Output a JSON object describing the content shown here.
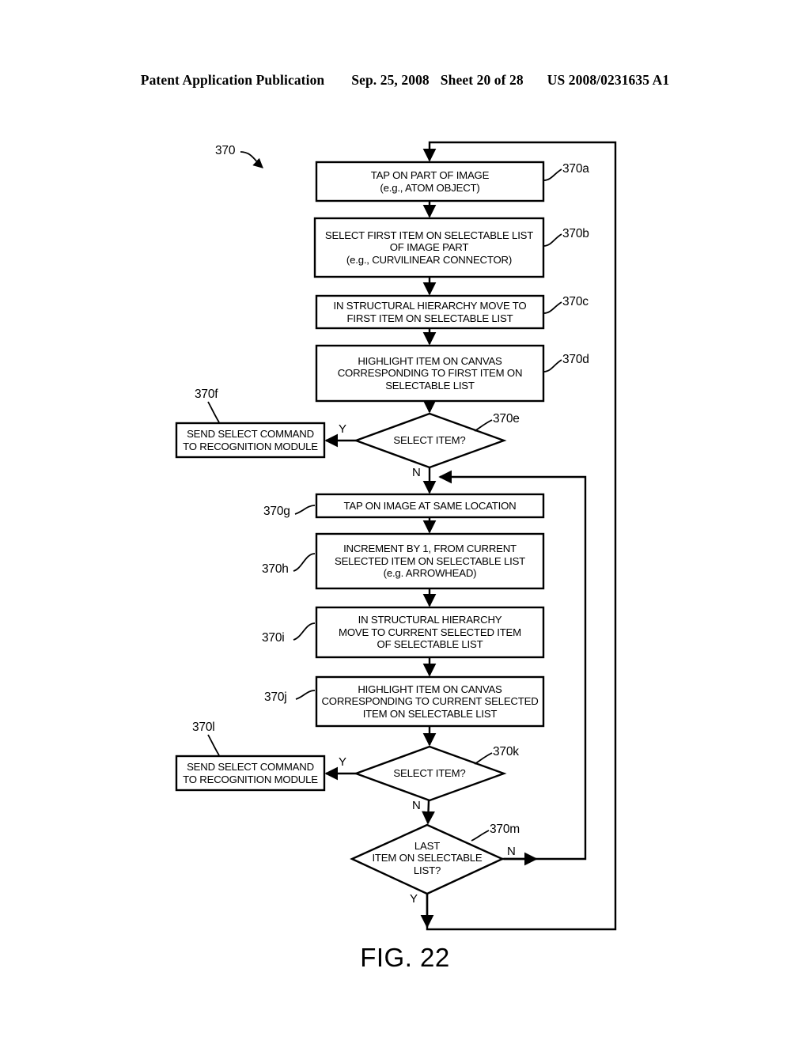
{
  "header": {
    "publication": "Patent Application Publication",
    "date": "Sep. 25, 2008",
    "sheet": "Sheet 20 of 28",
    "number": "US 2008/0231635 A1"
  },
  "figure": {
    "caption": "FIG. 22",
    "diagram_label": "370",
    "line_color": "#000000",
    "fill_color": "#ffffff"
  },
  "nodes": {
    "n370a": {
      "ref": "370a",
      "text": "TAP ON PART OF IMAGE\n(e.g., ATOM OBJECT)"
    },
    "n370b": {
      "ref": "370b",
      "text": "SELECT FIRST ITEM ON SELECTABLE LIST\nOF IMAGE PART\n(e.g., CURVILINEAR CONNECTOR)"
    },
    "n370c": {
      "ref": "370c",
      "text": "IN STRUCTURAL HIERARCHY MOVE TO\nFIRST ITEM ON SELECTABLE LIST"
    },
    "n370d": {
      "ref": "370d",
      "text": "HIGHLIGHT ITEM ON CANVAS\nCORRESPONDING TO FIRST ITEM ON\nSELECTABLE LIST"
    },
    "n370e": {
      "ref": "370e",
      "text": "SELECT ITEM?"
    },
    "n370f": {
      "ref": "370f",
      "text": "SEND SELECT COMMAND\nTO RECOGNITION MODULE"
    },
    "n370g": {
      "ref": "370g",
      "text": "TAP ON IMAGE AT SAME LOCATION"
    },
    "n370h": {
      "ref": "370h",
      "text": "INCREMENT BY 1, FROM CURRENT\nSELECTED ITEM ON SELECTABLE LIST\n(e.g. ARROWHEAD)"
    },
    "n370i": {
      "ref": "370i",
      "text": "IN STRUCTURAL HIERARCHY\nMOVE TO CURRENT SELECTED ITEM\nOF SELECTABLE LIST"
    },
    "n370j": {
      "ref": "370j",
      "text": "HIGHLIGHT ITEM ON CANVAS\nCORRESPONDING TO CURRENT SELECTED\nITEM ON SELECTABLE LIST"
    },
    "n370k": {
      "ref": "370k",
      "text": "SELECT ITEM?"
    },
    "n370l": {
      "ref": "370l",
      "text": "SEND SELECT COMMAND\nTO RECOGNITION MODULE"
    },
    "n370m": {
      "ref": "370m",
      "text": "LAST\nITEM ON SELECTABLE\nLIST?"
    }
  },
  "branches": {
    "e_yes": "Y",
    "e_no": "N",
    "k_yes": "Y",
    "k_no": "N",
    "m_yes": "Y",
    "m_no": "N"
  }
}
